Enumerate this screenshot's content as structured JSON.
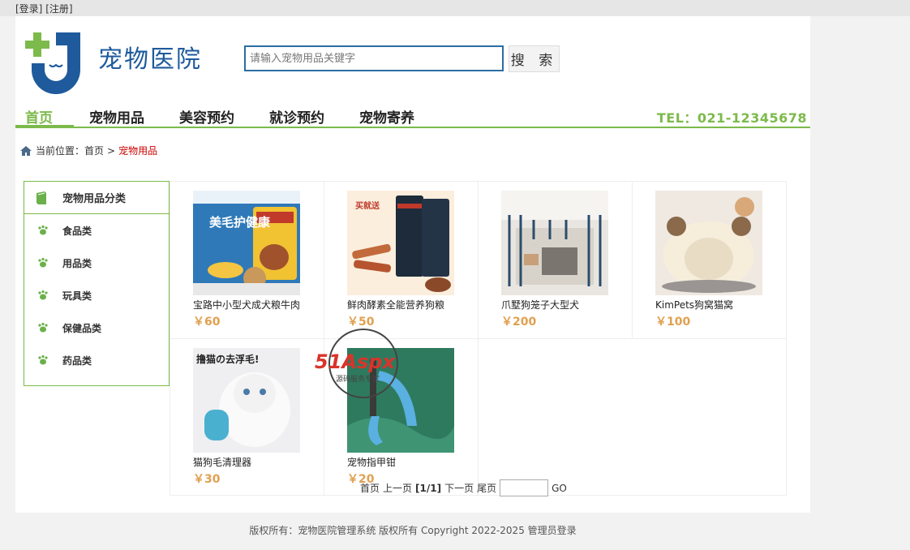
{
  "topbar": {
    "login": "[登录]",
    "register": "[注册]"
  },
  "logo": {
    "text": "宠物医院"
  },
  "search": {
    "placeholder": "请输入宠物用品关键字",
    "button": "搜 索"
  },
  "nav": {
    "items": [
      {
        "label": "首页"
      },
      {
        "label": "宠物用品"
      },
      {
        "label": "美容预约"
      },
      {
        "label": "就诊预约"
      },
      {
        "label": "宠物寄养"
      }
    ],
    "tel": "TEL：021-12345678"
  },
  "breadcrumb": {
    "prefix": "当前位置：首页",
    "sep": ">",
    "current": "宠物用品"
  },
  "sidebar": {
    "title": "宠物用品分类",
    "categories": [
      "食品类",
      "用品类",
      "玩具类",
      "保健品类",
      "药品类"
    ]
  },
  "products": [
    {
      "name": "宝路中小型犬成犬粮牛肉",
      "price": "￥60",
      "img_text": "美毛护健康"
    },
    {
      "name": "鲜肉酵素全能营养狗粮",
      "price": "￥50",
      "img_text": "买就送"
    },
    {
      "name": "爪墅狗笼子大型犬",
      "price": "￥200",
      "img_text": ""
    },
    {
      "name": "KimPets狗窝猫窝",
      "price": "￥100",
      "img_text": ""
    },
    {
      "name": "猫狗毛清理器",
      "price": "￥30",
      "img_text": "撸猫の去浮毛!"
    },
    {
      "name": "宠物指甲钳",
      "price": "￥20",
      "img_text": ""
    }
  ],
  "pager": {
    "first": "首页",
    "prev": "上一页",
    "info": "[1/1]",
    "next": "下一页",
    "last": "尾页",
    "go": "GO"
  },
  "footer": {
    "text": "版权所有：宠物医院管理系统 版权所有 Copyright 2022-2025 管理员登录"
  },
  "watermark": {
    "text": "51Aspx",
    "sub": "源码服务专家"
  },
  "colors": {
    "accent": "#7cba4b",
    "price": "#e0a050",
    "logo_blue": "#1e5a9c",
    "current": "#cc0000"
  }
}
